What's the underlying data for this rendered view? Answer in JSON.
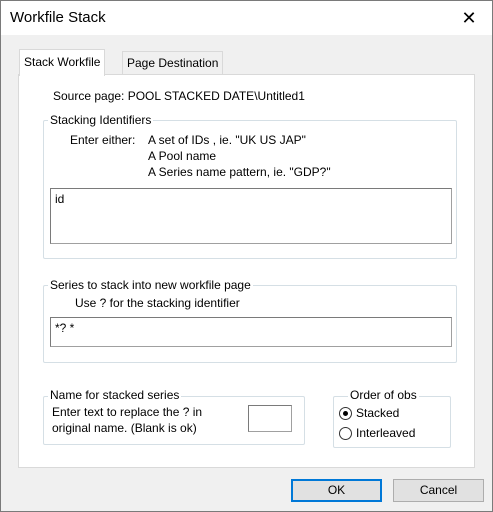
{
  "window": {
    "title": "Workfile Stack",
    "close_glyph": "✕"
  },
  "tabs": [
    {
      "label": "Stack Workfile",
      "active": true
    },
    {
      "label": "Page Destination",
      "active": false
    }
  ],
  "source_page": "Source page: POOL STACKED DATE\\Untitled1",
  "stacking": {
    "legend": "Stacking Identifiers",
    "enter_either": "Enter either:",
    "option1": "A set of IDs ,  ie. \"UK US JAP\"",
    "option2": "A Pool name",
    "option3": "A Series name pattern,  ie. \"GDP?\"",
    "value": "id"
  },
  "series": {
    "legend": "Series to stack into new workfile page",
    "hint": "Use ? for the stacking identifier",
    "value": "*? *"
  },
  "name_group": {
    "legend": "Name for stacked series",
    "line1": "Enter text to replace the ? in",
    "line2": "original name. (Blank is ok)",
    "value": ""
  },
  "order": {
    "legend": "Order of obs",
    "options": [
      {
        "label": "Stacked",
        "selected": true
      },
      {
        "label": "Interleaved",
        "selected": false
      }
    ]
  },
  "buttons": {
    "ok": "OK",
    "cancel": "Cancel"
  },
  "colors": {
    "accent": "#0078d7"
  }
}
